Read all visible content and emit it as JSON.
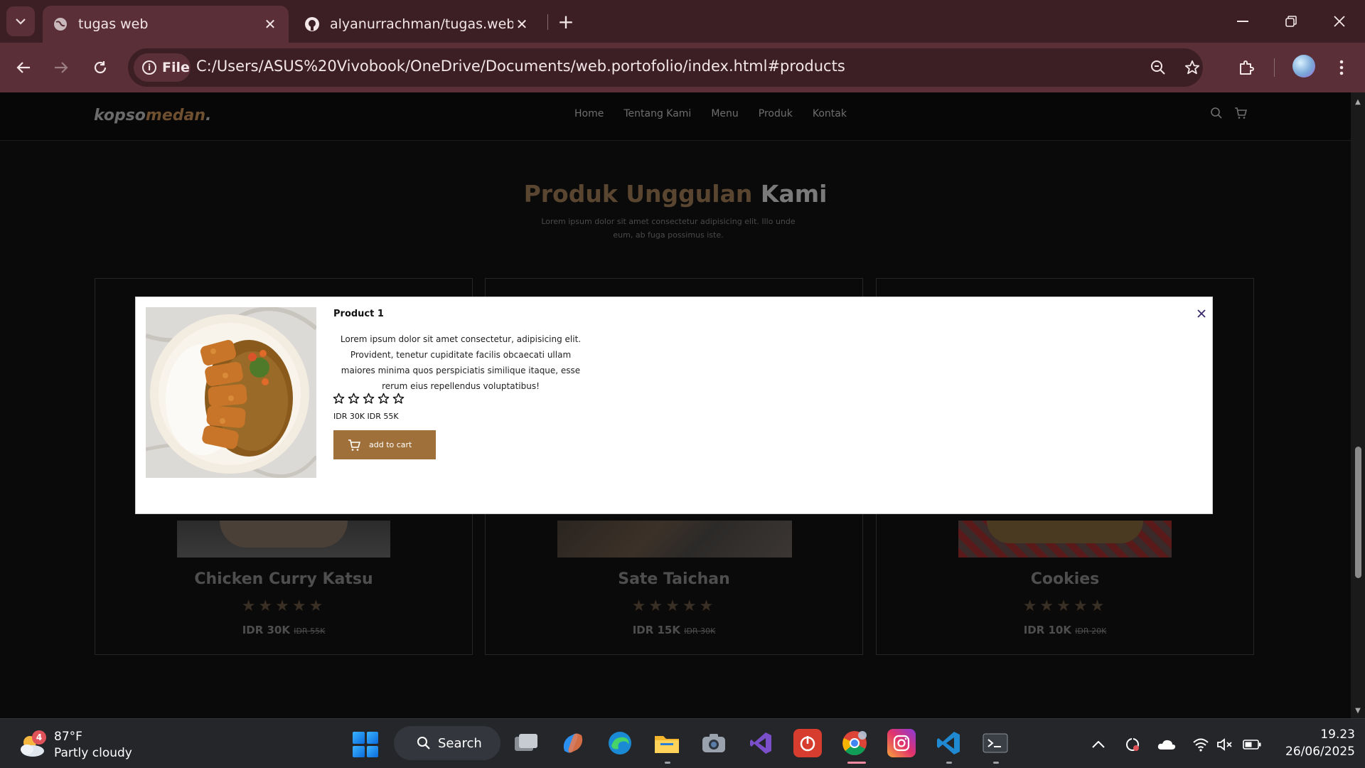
{
  "browser": {
    "tabs": [
      {
        "title": "tugas web",
        "favicon": "globe-icon",
        "active": true
      },
      {
        "title": "alyanurrachman/tugas.web.portofolio",
        "favicon": "github-icon",
        "active": false
      }
    ],
    "address": {
      "chip_label": "File",
      "url": "C:/Users/ASUS%20Vivobook/OneDrive/Documents/web.portofolio/index.html#products"
    }
  },
  "site": {
    "logo": {
      "part1": "kopso",
      "part2": "medan",
      "dot": "."
    },
    "menu": [
      "Home",
      "Tentang Kami",
      "Menu",
      "Produk",
      "Kontak"
    ],
    "section": {
      "title_accent": "Produk Unggulan",
      "title_rest": "Kami",
      "description": "Lorem ipsum dolor sit amet consectetur adipisicing elit. Illo unde eum, ab fuga possimus iste."
    },
    "products": [
      {
        "name": "Chicken Curry Katsu",
        "price": "IDR 30K",
        "old_price": "IDR 55K",
        "stars": "★★★★★"
      },
      {
        "name": "Sate Taichan",
        "price": "IDR 15K",
        "old_price": "IDR 30K",
        "stars": "★★★★★"
      },
      {
        "name": "Cookies",
        "price": "IDR 10K",
        "old_price": "IDR 20K",
        "stars": "★★★★★"
      }
    ]
  },
  "modal": {
    "title": "Product 1",
    "description": "Lorem ipsum dolor sit amet consectetur, adipisicing elit. Provident, tenetur cupiditate facilis obcaecati ullam maiores minima quos perspiciatis similique itaque, esse rerum eius repellendus voluptatibus!",
    "price": "IDR 30K IDR 55K",
    "rating_stars": 5,
    "button_label": "add to cart",
    "close_icon": "x-icon"
  },
  "taskbar": {
    "weather": {
      "temp": "87°F",
      "condition": "Partly cloudy",
      "badge": "4"
    },
    "search_label": "Search",
    "time": "19.23",
    "date": "26/06/2025"
  },
  "colors": {
    "chrome_dark": "#3c1e25",
    "chrome_light": "#5a2f38",
    "accent_brown": "#a0703a"
  }
}
